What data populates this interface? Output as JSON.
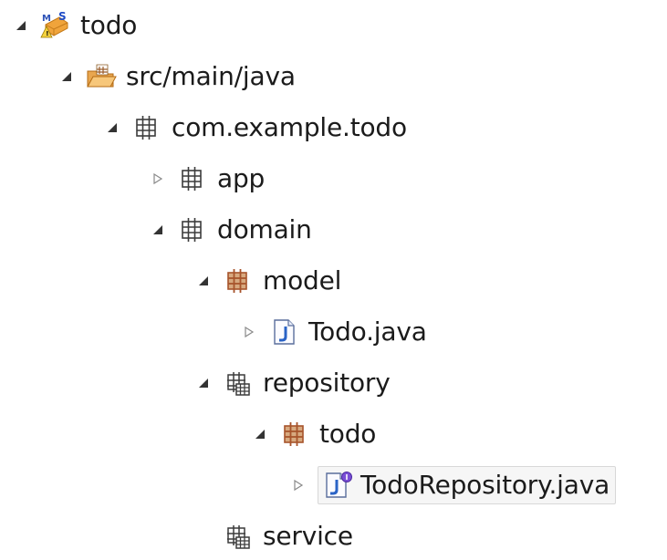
{
  "tree": {
    "nodes": [
      {
        "label": "todo",
        "icon": "maven-project-icon",
        "expanded": true
      },
      {
        "label": "src/main/java",
        "icon": "source-folder-icon",
        "expanded": true
      },
      {
        "label": "com.example.todo",
        "icon": "package-icon",
        "expanded": true
      },
      {
        "label": "app",
        "icon": "package-icon",
        "expanded": false
      },
      {
        "label": "domain",
        "icon": "package-icon",
        "expanded": true
      },
      {
        "label": "model",
        "icon": "package-icon",
        "expanded": true
      },
      {
        "label": "Todo.java",
        "icon": "java-file-icon",
        "expanded": false
      },
      {
        "label": "repository",
        "icon": "package-icon",
        "expanded": true
      },
      {
        "label": "todo",
        "icon": "package-icon",
        "expanded": true
      },
      {
        "label": "TodoRepository.java",
        "icon": "java-interface-file-icon",
        "expanded": false,
        "selected": true
      },
      {
        "label": "service",
        "icon": "package-icon",
        "expanded": null
      }
    ]
  },
  "colors": {
    "text": "#1b1b1b",
    "package_grid": "#3c3c3c",
    "package_brown": "#a7542b",
    "java_blue": "#2a63c6",
    "maven_orange": "#f0a43b",
    "selection_bg": "#f6f6f6",
    "selection_border": "#d8d8d8"
  }
}
